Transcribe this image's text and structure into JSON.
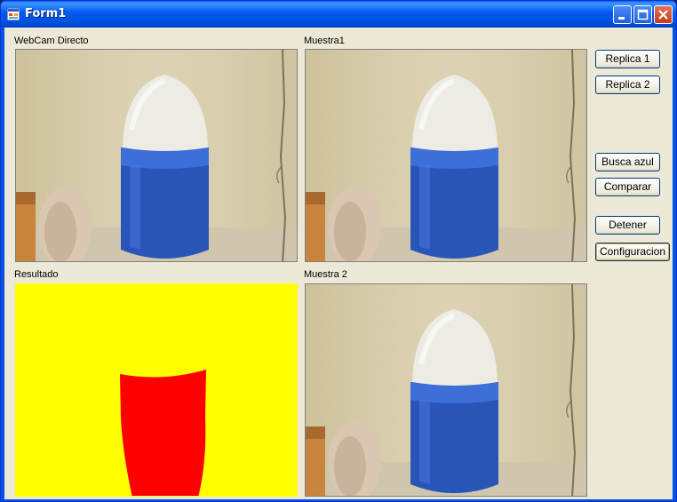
{
  "window": {
    "title": "Form1"
  },
  "panels": {
    "webcam": {
      "label": "WebCam Directo"
    },
    "sample1": {
      "label": "Muestra1"
    },
    "result": {
      "label": "Resultado"
    },
    "sample2": {
      "label": "Muestra 2"
    }
  },
  "buttons": {
    "replica1": "Replica 1",
    "replica2": "Replica 2",
    "busca_azul": "Busca azul",
    "comparar": "Comparar",
    "detener": "Detener",
    "configuracion": "Configuracion"
  },
  "colors": {
    "result_background": "#ffff00",
    "result_blob": "#ff0000",
    "wall": "#d9cfb0",
    "cylinder_blue": "#2a55b8",
    "dome_white": "#ecebe4"
  }
}
